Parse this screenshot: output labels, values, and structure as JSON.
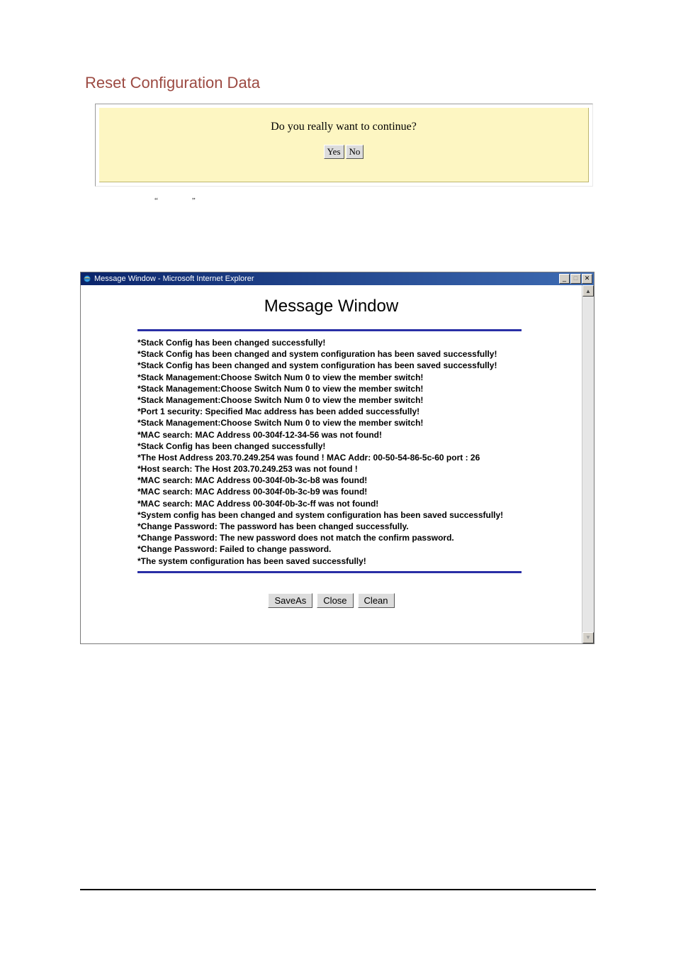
{
  "section": {
    "title": "Reset Configuration Data",
    "prompt": "Do you really want to continue?",
    "yes_label": "Yes",
    "no_label": "No"
  },
  "ie_window": {
    "title": "Message Window - Microsoft Internet Explorer",
    "content_title": "Message Window",
    "buttons": {
      "saveas": "SaveAs",
      "close": "Close",
      "clean": "Clean"
    },
    "messages": [
      "*Stack Config has been changed successfully!",
      "*Stack Config has been changed and system configuration has been saved successfully!",
      "*Stack Config has been changed and system configuration has been saved successfully!",
      "*Stack Management:Choose Switch Num 0 to view the member switch!",
      "*Stack Management:Choose Switch Num 0 to view the member switch!",
      "*Stack Management:Choose Switch Num 0 to view the member switch!",
      "*Port 1 security: Specified Mac address has been added successfully!",
      "*Stack Management:Choose Switch Num 0 to view the member switch!",
      "*MAC search: MAC Address 00-304f-12-34-56 was not found!",
      "*Stack Config has been changed successfully!",
      "*The Host Address 203.70.249.254 was found ! MAC Addr: 00-50-54-86-5c-60 port : 26",
      "*Host search: The Host 203.70.249.253 was not found !",
      "*MAC search: MAC Address 00-304f-0b-3c-b8 was found!",
      "*MAC search: MAC Address 00-304f-0b-3c-b9 was found!",
      "*MAC search: MAC Address 00-304f-0b-3c-ff was not found!",
      "*System config has been changed and system configuration has been saved successfully!",
      "*Change Password: The password has been changed successfully.",
      "*Change Password: The new password does not match the confirm password.",
      "*Change Password: Failed to change password.",
      "*The system configuration has been saved successfully!"
    ]
  }
}
